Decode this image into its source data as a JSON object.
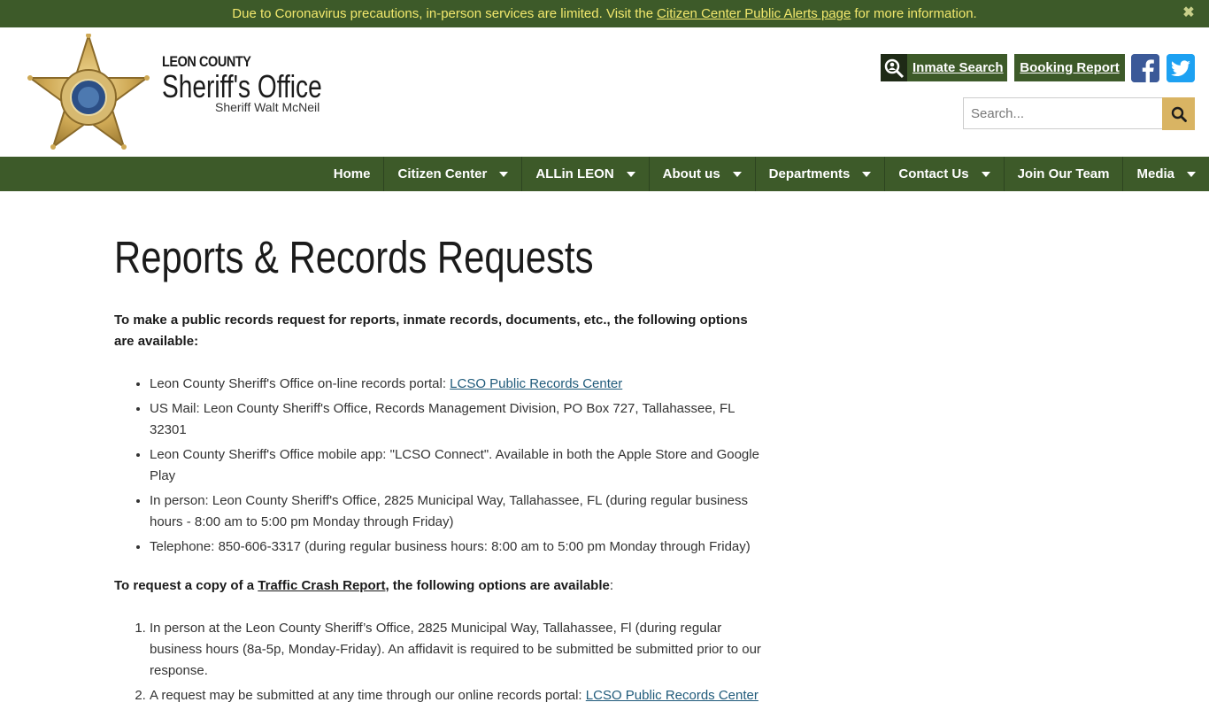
{
  "alert": {
    "text_before": "Due to Coronavirus precautions, in-person services are limited. Visit the",
    "link": "Citizen Center Public Alerts page",
    "text_after": "for more information.",
    "close": "✖"
  },
  "brand": {
    "county": "LEON COUNTY",
    "office": "Sheriff's Office",
    "sheriff": "Sheriff Walt McNeil"
  },
  "header": {
    "inmate_search": "Inmate Search",
    "booking_report": "Booking Report",
    "search_placeholder": "Search..."
  },
  "nav": {
    "items": [
      {
        "label": "Home"
      },
      {
        "label": "Citizen Center"
      },
      {
        "label": "ALLin LEON"
      },
      {
        "label": "About us"
      },
      {
        "label": "Departments"
      },
      {
        "label": "Contact Us"
      },
      {
        "label": "Join Our Team"
      },
      {
        "label": "Media"
      }
    ]
  },
  "main": {
    "title": "Reports & Records Requests",
    "intro": "To make a public records request for reports, inmate records, documents, etc., the following options are available:",
    "records_options": [
      {
        "text": "Leon County Sheriff's Office on-line records portal: ",
        "link": "LCSO Public Records Center"
      },
      {
        "text": "US Mail: Leon County Sheriff's Office, Records Management Division, PO Box 727, Tallahassee, FL 32301"
      },
      {
        "text": "Leon County Sheriff's Office mobile app: \"LCSO Connect\". Available in both the Apple Store and Google Play"
      },
      {
        "text": "In person: Leon County Sheriff's Office, 2825 Municipal Way, Tallahassee, FL (during regular business hours - 8:00 am to 5:00 pm Monday through Friday)"
      },
      {
        "text": "Telephone: 850-606-3317 (during regular business hours: 8:00 am to 5:00 pm Monday through Friday)"
      }
    ],
    "crash_intro_before": "To request a copy of a ",
    "crash_link": "Traffic Crash Report",
    "crash_intro_after": ", the following options are available",
    "crash_colon": ":",
    "crash_options": [
      {
        "text": "In person at the Leon County Sheriff’s Office, 2825 Municipal Way, Tallahassee, Fl (during regular business hours (8a-5p, Monday-Friday). An affidavit is required to be submitted be submitted prior to our response."
      },
      {
        "text": "A request may be submitted at any time through our online records portal: ",
        "link": "LCSO Public Records Center"
      }
    ]
  },
  "colors": {
    "primary_green": "#3d5a29",
    "alert_text": "#f2e86d",
    "search_button": "#d9b463",
    "link_blue": "#1f5a7a"
  }
}
